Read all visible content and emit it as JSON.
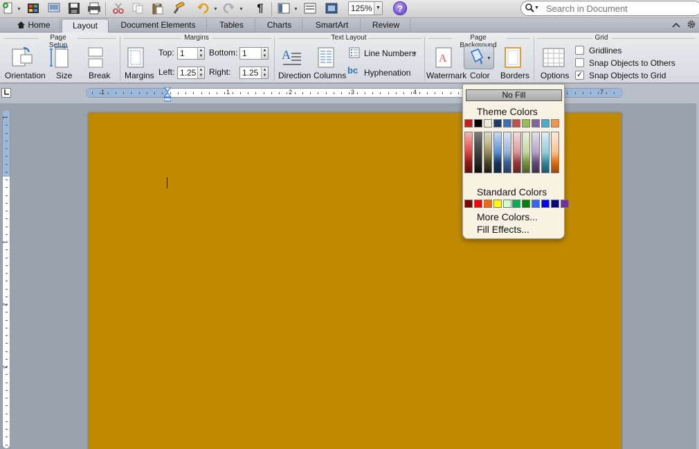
{
  "toolbar": {
    "zoom": "125%",
    "help_label": "?",
    "search_placeholder": "Search in Document",
    "icons": [
      "new-document-icon",
      "gallery-icon",
      "open-icon",
      "save-icon",
      "print-icon",
      "cut-icon",
      "copy-icon",
      "paste-icon",
      "format-painter-icon",
      "undo-icon",
      "redo-icon",
      "pilcrow-icon",
      "sidebar-icon",
      "toolbox-icon",
      "media-browser-icon"
    ],
    "pilcrow": "¶"
  },
  "ribbon_tabs": [
    {
      "label": "Home",
      "icon": "home-icon"
    },
    {
      "label": "Layout",
      "active": true
    },
    {
      "label": "Document Elements"
    },
    {
      "label": "Tables"
    },
    {
      "label": "Charts"
    },
    {
      "label": "SmartArt"
    },
    {
      "label": "Review"
    }
  ],
  "ribbon": {
    "page_setup": {
      "label": "Page Setup",
      "orientation": "Orientation",
      "size": "Size",
      "break": "Break"
    },
    "margins": {
      "label": "Margins",
      "margins_button": "Margins",
      "top_label": "Top:",
      "top_value": "1",
      "bottom_label": "Bottom:",
      "bottom_value": "1",
      "left_label": "Left:",
      "left_value": "1.25",
      "right_label": "Right:",
      "right_value": "1.25"
    },
    "text_layout": {
      "label": "Text Layout",
      "direction": "Direction",
      "columns": "Columns",
      "line_numbers": "Line Numbers",
      "hyphenation": "Hyphenation",
      "hyphen_icon_text": "bc"
    },
    "page_background": {
      "label": "Page Background",
      "watermark": "Watermark",
      "color": "Color",
      "borders": "Borders"
    },
    "grid": {
      "label": "Grid",
      "options": "Options",
      "gridlines": "Gridlines",
      "gridlines_checked": false,
      "snap_others": "Snap Objects to Others",
      "snap_others_checked": false,
      "snap_grid": "Snap Objects to Grid",
      "snap_grid_checked": true,
      "check_mark": "✓"
    }
  },
  "hruler": {
    "numbers": [
      "1",
      "1",
      "2",
      "3",
      "4",
      "7"
    ]
  },
  "vruler": {
    "numbers": [
      "1",
      "1",
      "2",
      "3"
    ]
  },
  "document": {
    "page_color": "#c08a00"
  },
  "color_dropdown": {
    "no_fill": "No Fill",
    "theme_colors_label": "Theme Colors",
    "theme_colors": [
      "#c0211a",
      "#000000",
      "#eee9d6",
      "#1f3a63",
      "#3e6fb2",
      "#c0504d",
      "#9bbb59",
      "#8064a2",
      "#4bacc6",
      "#f79646"
    ],
    "theme_tints": [
      [
        "#f2b8b5",
        "#ec7a75",
        "#d9453f",
        "#8f1812",
        "#5f0f0b"
      ],
      [
        "#7f7f7f",
        "#595959",
        "#3f3f3f",
        "#262626",
        "#0c0c0c"
      ],
      [
        "#ddd9c3",
        "#c4bd97",
        "#948a54",
        "#4a452a",
        "#1d1b10"
      ],
      [
        "#c6d9f1",
        "#8db3e2",
        "#548dd4",
        "#17365d",
        "#0f243e"
      ],
      [
        "#dbe5f1",
        "#b8cce4",
        "#95b3d7",
        "#366092",
        "#244061"
      ],
      [
        "#f2dcdb",
        "#e6b9b8",
        "#d99694",
        "#953735",
        "#632523"
      ],
      [
        "#ebf1dd",
        "#d7e3bc",
        "#c3d69b",
        "#76923c",
        "#4f6128"
      ],
      [
        "#e5e0ec",
        "#ccc1d9",
        "#b2a1c7",
        "#5f497a",
        "#3f3151"
      ],
      [
        "#dbeef3",
        "#b7dde8",
        "#92cddc",
        "#31859b",
        "#205867"
      ],
      [
        "#fdeada",
        "#fbd5b5",
        "#fac08f",
        "#e36c09",
        "#974806"
      ]
    ],
    "standard_colors_label": "Standard Colors",
    "standard_colors": [
      "#7f0000",
      "#ff0000",
      "#ff6600",
      "#ffff00",
      "#ccffcc",
      "#00b050",
      "#008000",
      "#3366ff",
      "#0000ff",
      "#000080",
      "#7030a0"
    ],
    "more_colors": "More Colors...",
    "fill_effects": "Fill Effects..."
  }
}
